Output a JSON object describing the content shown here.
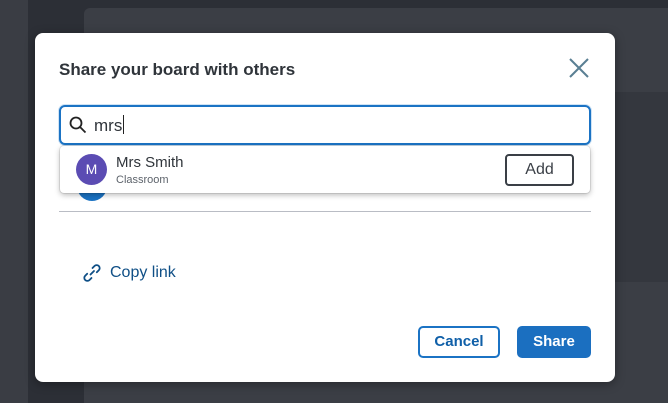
{
  "dialog": {
    "title": "Share your board with others"
  },
  "search": {
    "value": "mrs",
    "placeholder": ""
  },
  "results": [
    {
      "initial": "M",
      "name": "Mrs Smith",
      "type": "Classroom",
      "action": "Add"
    }
  ],
  "copy_link": {
    "label": "Copy link"
  },
  "footer": {
    "cancel_label": "Cancel",
    "share_label": "Share"
  },
  "colors": {
    "accent": "#1b73c4",
    "avatar": "#5b4cb3",
    "link": "#0f4f86"
  },
  "icons": [
    "close-icon",
    "search-icon",
    "link-icon"
  ]
}
